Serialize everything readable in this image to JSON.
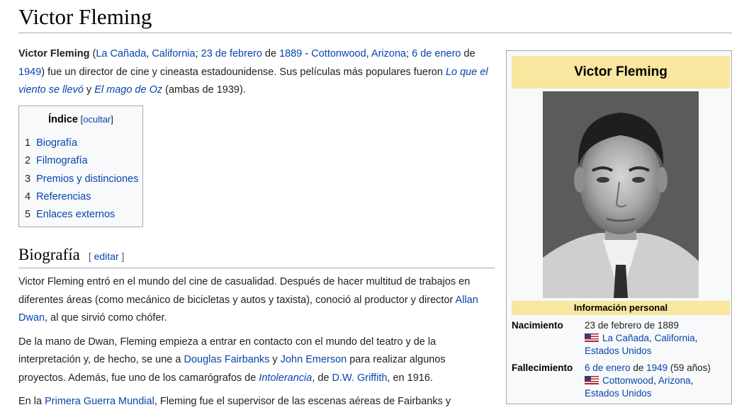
{
  "page": {
    "title": "Victor Fleming"
  },
  "intro": {
    "name": "Victor Fleming",
    "open_paren": " (",
    "birth_city": "La Cañada",
    "sep1": ", ",
    "birth_state": "California",
    "sep2": "; ",
    "birth_date": "23 de febrero",
    "de1": " de ",
    "birth_year": "1889",
    "dash": " - ",
    "death_city": "Cottonwood",
    "sep3": ", ",
    "death_state": "Arizona",
    "sep4": "; ",
    "death_date": "6 de enero",
    "de2": " de ",
    "death_year": "1949",
    "rest1": ") fue un director de cine y cineasta estadounidense. Sus películas más populares fueron ",
    "film1": "Lo que el viento se llevó",
    "y": " y ",
    "film2": "El mago de Oz",
    "rest2": " (ambas de 1939)."
  },
  "toc": {
    "title": "Índice",
    "toggle_open": " [",
    "toggle": "ocultar",
    "toggle_close": "]",
    "items": [
      {
        "num": "1",
        "label": "Biografía"
      },
      {
        "num": "2",
        "label": "Filmografía"
      },
      {
        "num": "3",
        "label": "Premios y distinciones"
      },
      {
        "num": "4",
        "label": "Referencias"
      },
      {
        "num": "5",
        "label": "Enlaces externos"
      }
    ]
  },
  "section": {
    "heading": "Biografía",
    "edit_open": "[ ",
    "edit": "editar",
    "edit_close": " ]",
    "p1_a": "Victor Fleming entró en el mundo del cine de casualidad. Después de hacer multitud de trabajos en diferentes áreas (como mecánico de bicicletas y autos y taxista), conoció al productor y director ",
    "p1_link": "Allan Dwan",
    "p1_b": ", al que sirvió como chófer.",
    "p2_a": "De la mano de Dwan, Fleming empieza a entrar en contacto con el mundo del teatro y de la interpretación y, de hecho, se une a ",
    "p2_link1": "Douglas Fairbanks",
    "p2_y": " y ",
    "p2_link2": "John Emerson",
    "p2_b": " para realizar algunos proyectos. Además, fue uno de los camarógrafos de ",
    "p2_film": "Intolerancia",
    "p2_c": ", de ",
    "p2_link3": "D.W. Griffith",
    "p2_d": ", en 1916.",
    "p3_a": "En la ",
    "p3_link": "Primera Guerra Mundial",
    "p3_b": ", Fleming fue el supervisor de las escenas aéreas de Fairbanks y"
  },
  "infobox": {
    "title": "Victor Fleming",
    "subheader": "Información personal",
    "birth": {
      "label": "Nacimiento",
      "date": "23 de febrero de 1889",
      "place1": "La Cañada",
      "comma": ", ",
      "place2": "California",
      "trail": ",",
      "country": "Estados Unidos"
    },
    "death": {
      "label": "Fallecimiento",
      "date_link": "6 de enero",
      "de": " de ",
      "year_link": "1949",
      "age": " (59 años)",
      "place1": "Cottonwood",
      "comma": ", ",
      "place2": "Arizona",
      "trail": ",",
      "country": "Estados Unidos"
    }
  }
}
